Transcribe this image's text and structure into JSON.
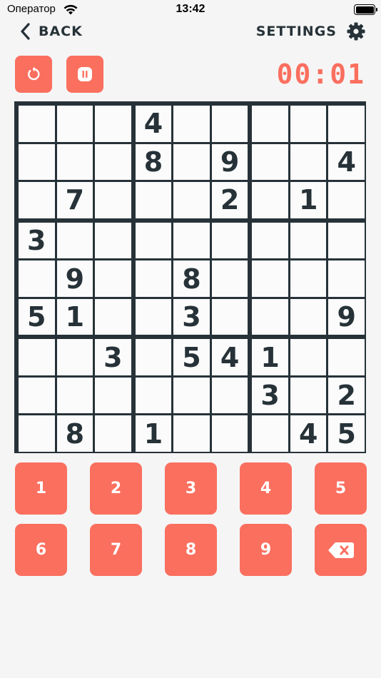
{
  "status_bar": {
    "carrier": "Оператор",
    "time": "13:42"
  },
  "nav": {
    "back_label": "BACK",
    "settings_label": "SETTINGS"
  },
  "controls": {
    "restart_icon": "restart-icon",
    "pause_icon": "pause-icon",
    "timer": "00:01"
  },
  "colors": {
    "accent": "#fb6f5f",
    "dark": "#263238",
    "background": "#f5f5f5",
    "cell": "#fbfbfb"
  },
  "board": [
    [
      "",
      "",
      "",
      "4",
      "",
      "",
      "",
      "",
      ""
    ],
    [
      "",
      "",
      "",
      "8",
      "",
      "9",
      "",
      "",
      "4"
    ],
    [
      "",
      "7",
      "",
      "",
      "",
      "2",
      "",
      "1",
      ""
    ],
    [
      "3",
      "",
      "",
      "",
      "",
      "",
      "",
      "",
      ""
    ],
    [
      "",
      "9",
      "",
      "",
      "8",
      "",
      "",
      "",
      ""
    ],
    [
      "5",
      "1",
      "",
      "",
      "3",
      "",
      "",
      "",
      "9"
    ],
    [
      "",
      "",
      "3",
      "",
      "5",
      "4",
      "1",
      "",
      ""
    ],
    [
      "",
      "",
      "",
      "",
      "",
      "",
      "3",
      "",
      "2"
    ],
    [
      "",
      "8",
      "",
      "1",
      "",
      "",
      "",
      "4",
      "5"
    ]
  ],
  "keypad": [
    "1",
    "2",
    "3",
    "4",
    "5",
    "6",
    "7",
    "8",
    "9"
  ],
  "keypad_erase_icon": "backspace-icon"
}
